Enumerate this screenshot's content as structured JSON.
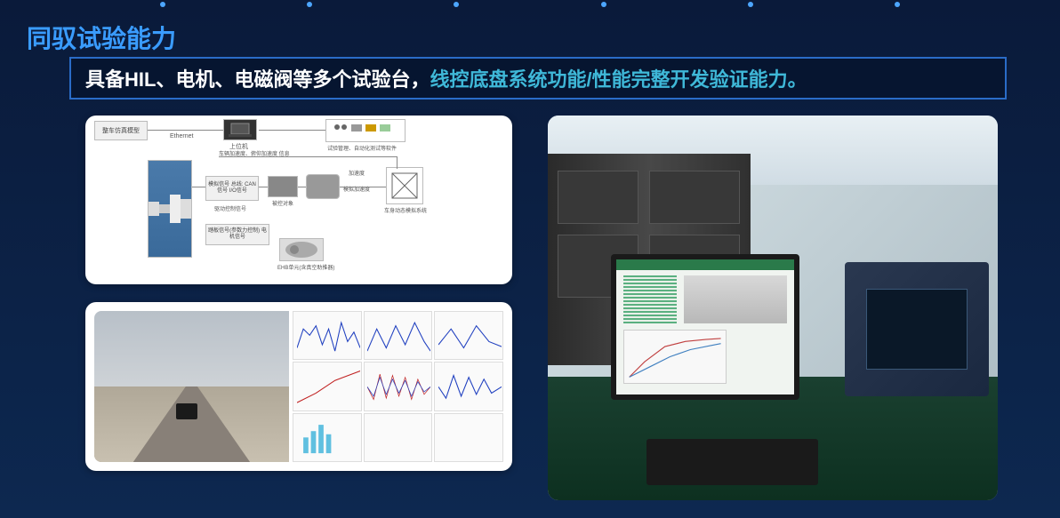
{
  "title": "同驭试验能力",
  "subtitle": {
    "part1": "具备HIL、电机、电磁阀等多个试验台，",
    "part2": "线控底盘系统功能/性能完整开发验证能力。"
  },
  "diagram": {
    "box_realtime": "整车仿真模型",
    "box_ethernet": "Ethernet",
    "box_uppc": "上位机",
    "box_testmgr": "试验管理、自动化测试等软件",
    "box_signal_info": "车辆加速度、俯仰加速度 信息",
    "box_rack": "",
    "box_analog": "模拟信号\n总线: CAN信号\nI/O信号",
    "box_drivectl": "驱动控制信号",
    "box_ecu": "被控对象",
    "box_accel": "加速度",
    "box_sim_accel": "模拟加速度",
    "box_dynsys": "车身动态模拟系统",
    "box_pedal": "踏板信号(参数力控制)\n电机信号",
    "box_ehb": "EHB单元(含真空助推器)"
  },
  "icons": {
    "laptop": "laptop-icon",
    "rack": "rack-icon",
    "controller": "controller-icon",
    "motor": "motor-icon",
    "rig": "rig-icon"
  }
}
